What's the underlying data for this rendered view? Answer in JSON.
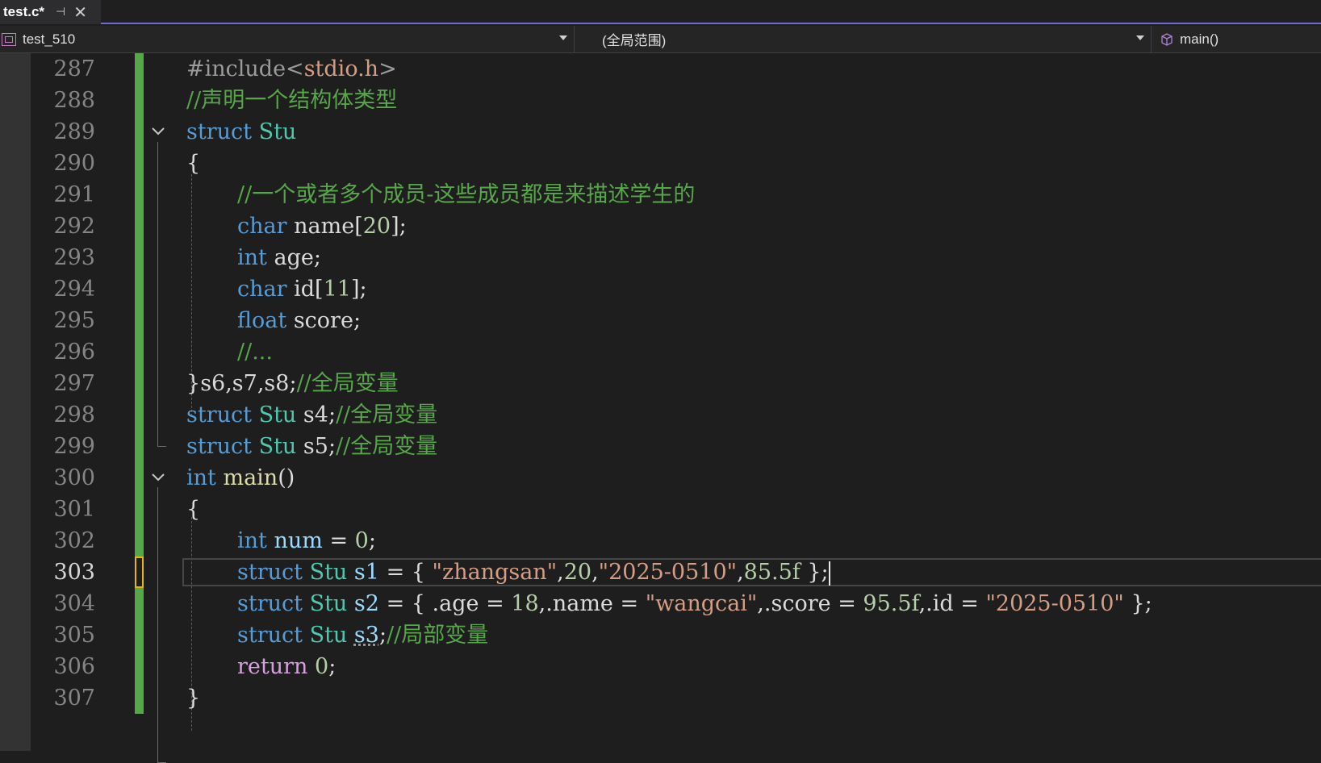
{
  "tab": {
    "title": "test.c*",
    "pin": "⊣",
    "close": "✕"
  },
  "nav": {
    "project": "test_510",
    "scope": "(全局范围)",
    "member": "main()"
  },
  "colors": {
    "accent": "#6c6cd8",
    "keyword": "#569cd6",
    "type": "#4ec9b0",
    "comment": "#57a64a",
    "string": "#d69d85",
    "number": "#b5cea8",
    "change_marker": "#57a64a",
    "caret_marker": "#e2b714"
  },
  "editor": {
    "current_line": 303,
    "lines": [
      {
        "n": "287",
        "text": "#include<stdio.h>"
      },
      {
        "n": "288",
        "text": "//声明一个结构体类型"
      },
      {
        "n": "289",
        "text": "struct Stu"
      },
      {
        "n": "290",
        "text": "{"
      },
      {
        "n": "291",
        "text": "//一个或者多个成员-这些成员都是来描述学生的"
      },
      {
        "n": "292",
        "text": "char name[20];"
      },
      {
        "n": "293",
        "text": "int age;"
      },
      {
        "n": "294",
        "text": "char id[11];"
      },
      {
        "n": "295",
        "text": "float score;"
      },
      {
        "n": "296",
        "text": "//..."
      },
      {
        "n": "297",
        "text": "}s6,s7,s8;//全局变量"
      },
      {
        "n": "298",
        "text": "struct Stu s4;//全局变量"
      },
      {
        "n": "299",
        "text": "struct Stu s5;//全局变量"
      },
      {
        "n": "300",
        "text": "int main()"
      },
      {
        "n": "301",
        "text": "{"
      },
      {
        "n": "302",
        "text": "int num = 0;"
      },
      {
        "n": "303",
        "text": "struct Stu s1 = { \"zhangsan\",20,\"2025-0510\",85.5f };"
      },
      {
        "n": "304",
        "text": "struct Stu s2 = { .age = 18,.name = \"wangcai\",.score = 95.5f,.id = \"2025-0510\" };"
      },
      {
        "n": "305",
        "text": "struct Stu s3;//局部变量"
      },
      {
        "n": "306",
        "text": "return 0;"
      },
      {
        "n": "307",
        "text": "}"
      }
    ]
  }
}
